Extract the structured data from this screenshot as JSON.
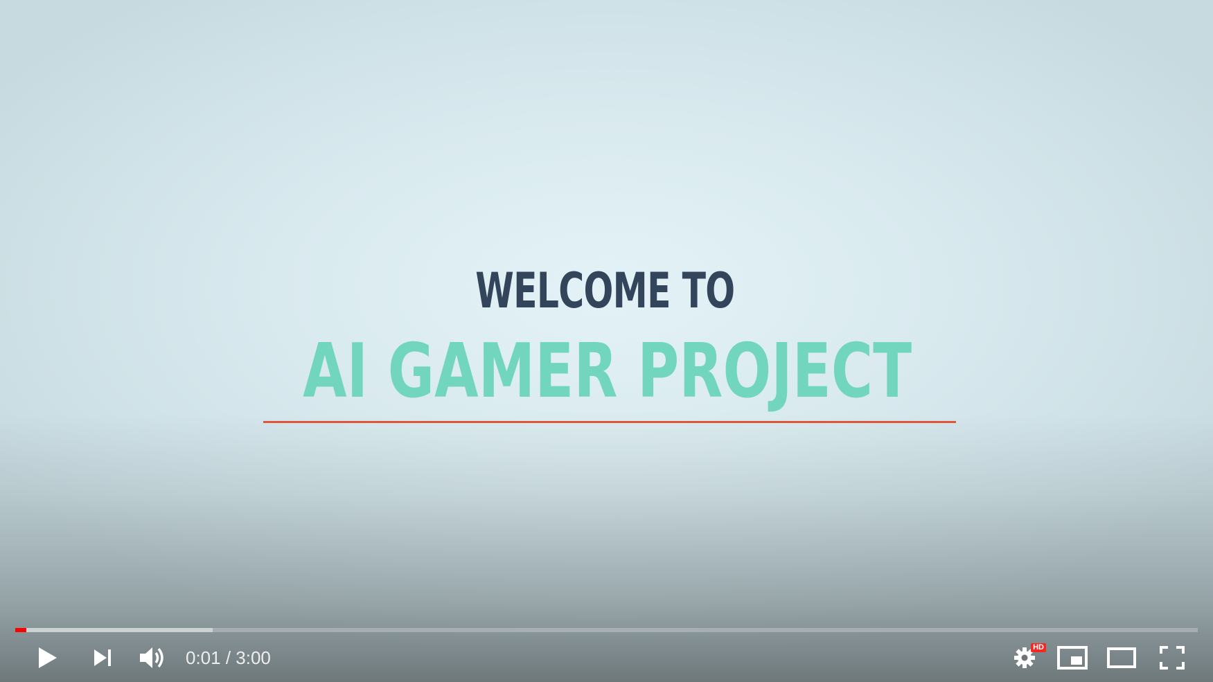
{
  "video": {
    "welcome_text": "WELCOME TO",
    "project_text": "AI GAMER PROJECT",
    "welcome_color": "#33455a",
    "project_color": "#72d6bf",
    "underline_color": "#e0563a"
  },
  "progress": {
    "played_fraction": 0.0094,
    "loaded_fraction": 0.167,
    "played_color": "#ff0000"
  },
  "controls": {
    "current_time": "0:01",
    "separator": " / ",
    "duration": "3:00",
    "play_icon": "play-icon",
    "next_icon": "next-icon",
    "volume_icon": "volume-icon",
    "settings_icon": "settings-icon",
    "hd_badge": "HD",
    "miniplayer_icon": "miniplayer-icon",
    "theater_icon": "theater-mode-icon",
    "fullscreen_icon": "fullscreen-icon"
  }
}
